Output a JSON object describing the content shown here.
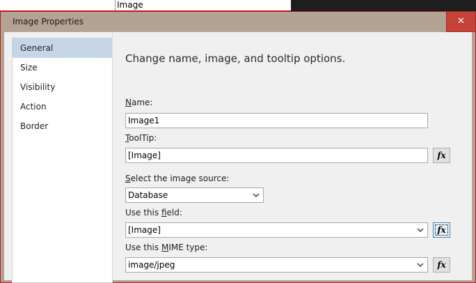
{
  "background": {
    "cell_text": "Image"
  },
  "dialog": {
    "title": "Image Properties",
    "close_glyph": "✕"
  },
  "sidebar": {
    "items": [
      {
        "label": "General",
        "active": true
      },
      {
        "label": "Size",
        "active": false
      },
      {
        "label": "Visibility",
        "active": false
      },
      {
        "label": "Action",
        "active": false
      },
      {
        "label": "Border",
        "active": false
      }
    ]
  },
  "general": {
    "heading": "Change name, image, and tooltip options.",
    "name_label_accel": "N",
    "name_label_rest": "ame:",
    "name_value": "Image1",
    "tooltip_label_accel": "T",
    "tooltip_label_rest": "oolTip:",
    "tooltip_value": "[Image]",
    "source_label_accel": "S",
    "source_label_rest": "elect the image source:",
    "source_value": "Database",
    "field_label_pre": "Use this ",
    "field_label_accel": "f",
    "field_label_post": "ield:",
    "field_value": "[Image]",
    "mime_label_pre": "Use this ",
    "mime_label_accel": "M",
    "mime_label_post": "IME type:",
    "mime_value": "image/jpeg",
    "fx_label": "fx"
  },
  "colors": {
    "titlebar": "#b3a394",
    "close_button": "#c74238",
    "active_nav": "#c5d6e8"
  }
}
